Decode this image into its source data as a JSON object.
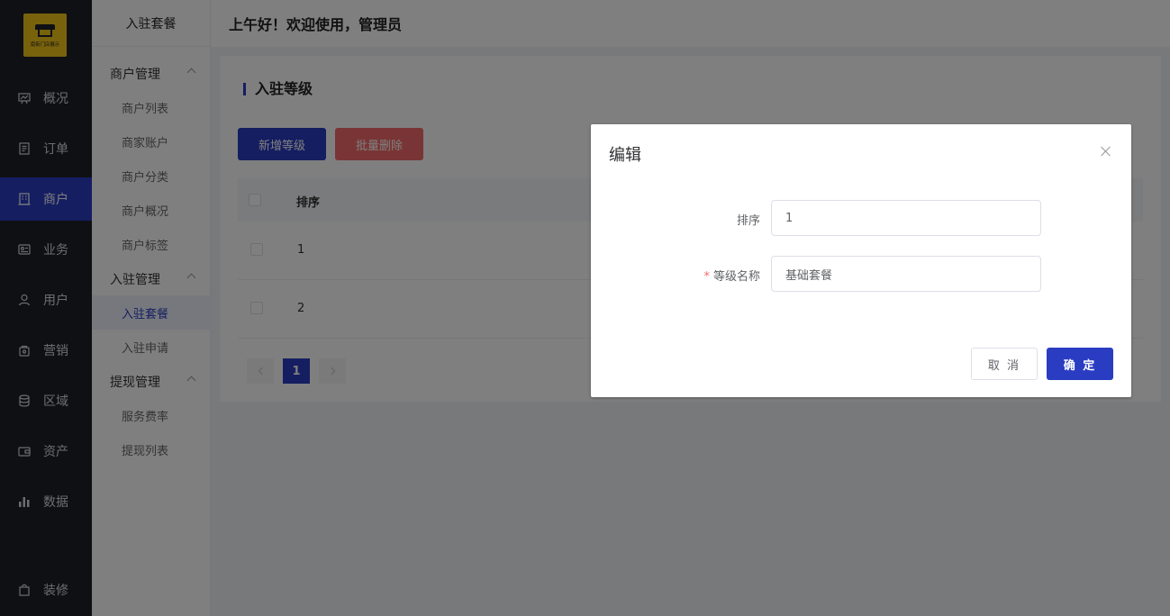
{
  "logo": {
    "text": "南街门店展示"
  },
  "nav": {
    "items": [
      {
        "label": "概况",
        "icon": "chart-board-icon"
      },
      {
        "label": "订单",
        "icon": "document-icon"
      },
      {
        "label": "商户",
        "icon": "building-icon"
      },
      {
        "label": "业务",
        "icon": "id-card-icon"
      },
      {
        "label": "用户",
        "icon": "user-icon"
      },
      {
        "label": "营销",
        "icon": "bag-icon"
      },
      {
        "label": "区域",
        "icon": "database-icon"
      },
      {
        "label": "资产",
        "icon": "wallet-icon"
      },
      {
        "label": "数据",
        "icon": "bar-chart-icon"
      },
      {
        "label": "装修",
        "icon": "shopping-bag-icon"
      }
    ],
    "active": "商户"
  },
  "submenu": {
    "title": "入驻套餐",
    "groups": [
      {
        "label": "商户管理",
        "items": [
          "商户列表",
          "商家账户",
          "商户分类",
          "商户概况",
          "商户标签"
        ]
      },
      {
        "label": "入驻管理",
        "items": [
          "入驻套餐",
          "入驻申请"
        ]
      },
      {
        "label": "提现管理",
        "items": [
          "服务费率",
          "提现列表"
        ]
      }
    ],
    "active": "入驻套餐"
  },
  "header": {
    "greeting": "上午好！欢迎使用，管理员"
  },
  "content": {
    "title": "入驻等级",
    "add_button": "新增等级",
    "batch_delete_button": "批量删除",
    "table": {
      "columns": [
        "排序"
      ],
      "rows": [
        {
          "sort": "1"
        },
        {
          "sort": "2"
        }
      ]
    },
    "pagination": {
      "current": "1"
    }
  },
  "dialog": {
    "title": "编辑",
    "fields": {
      "sort": {
        "label": "排序",
        "value": "1"
      },
      "level_name": {
        "label": "等级名称",
        "value": "基础套餐",
        "required": "*"
      }
    },
    "cancel": "取 消",
    "confirm": "确 定"
  },
  "colors": {
    "primary": "#2a3dc2",
    "danger": "#f26a6a",
    "nav_bg": "#1e2128",
    "logo": "#f0c419"
  }
}
